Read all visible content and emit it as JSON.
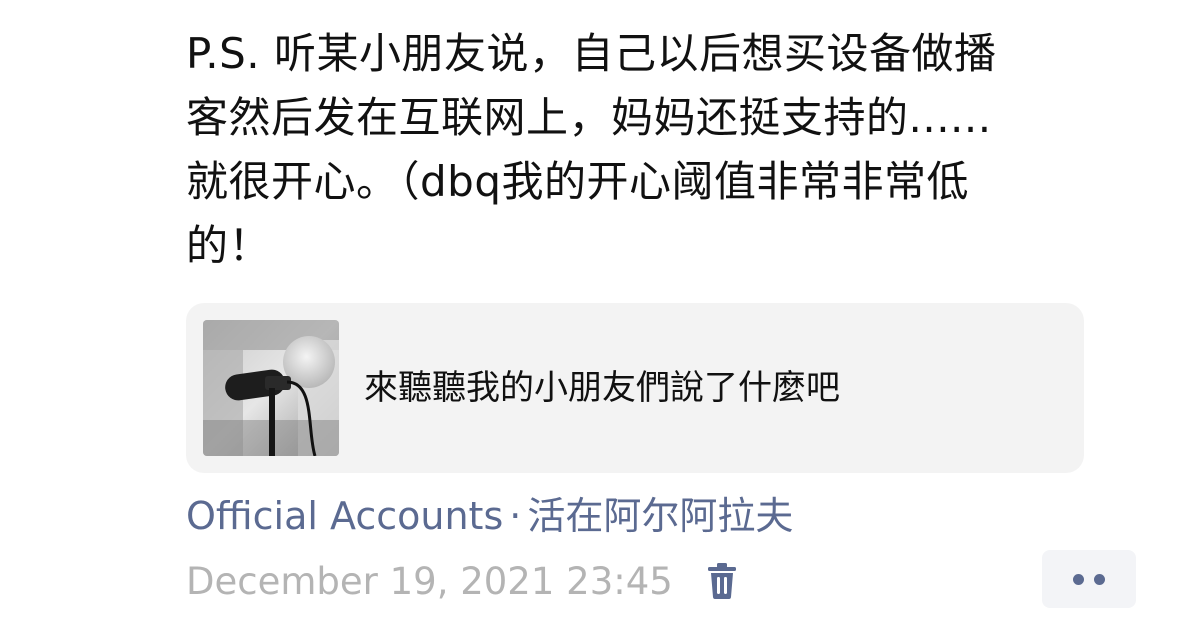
{
  "post": {
    "lines": [
      "P.S. 听某小朋友说，自己以后想买设备做播",
      "客然后发在互联网上，妈妈还挺支持的......",
      "就很开心。（dbq我的开心阈值非常非常低",
      "的！"
    ]
  },
  "share_card": {
    "title": "來聽聽我的小朋友們說了什麼吧",
    "thumbnail_icon": "microphone-icon"
  },
  "source": {
    "label": "Official Accounts",
    "separator": "·",
    "account_name": "活在阿尔阿拉夫"
  },
  "meta": {
    "timestamp": "December 19, 2021 23:45",
    "delete_icon": "trash-icon",
    "more_icon": "more-dots-icon"
  },
  "colors": {
    "link": "#5b6a91",
    "timestamp": "#b4b4b4",
    "card_bg": "#f3f3f3",
    "text": "#111111"
  }
}
